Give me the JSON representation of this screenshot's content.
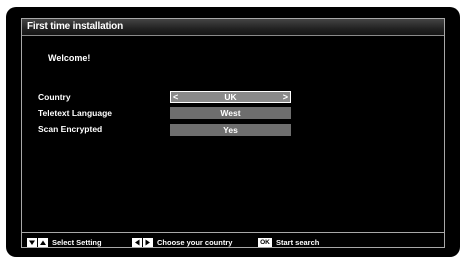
{
  "title": "First time installation",
  "welcome": "Welcome!",
  "settings": [
    {
      "label": "Country",
      "value": "UK",
      "selected": true
    },
    {
      "label": "Teletext Language",
      "value": "West",
      "selected": false
    },
    {
      "label": "Scan Encrypted",
      "value": "Yes",
      "selected": false
    }
  ],
  "arrows": {
    "left": "<",
    "right": ">"
  },
  "footer": {
    "select_setting": "Select Setting",
    "choose_country": "Choose your country",
    "ok_key": "OK",
    "start_search": "Start search"
  },
  "icons": {
    "down": "triangle-down-icon",
    "up": "triangle-up-icon",
    "left": "triangle-left-icon",
    "right": "triangle-right-icon"
  }
}
